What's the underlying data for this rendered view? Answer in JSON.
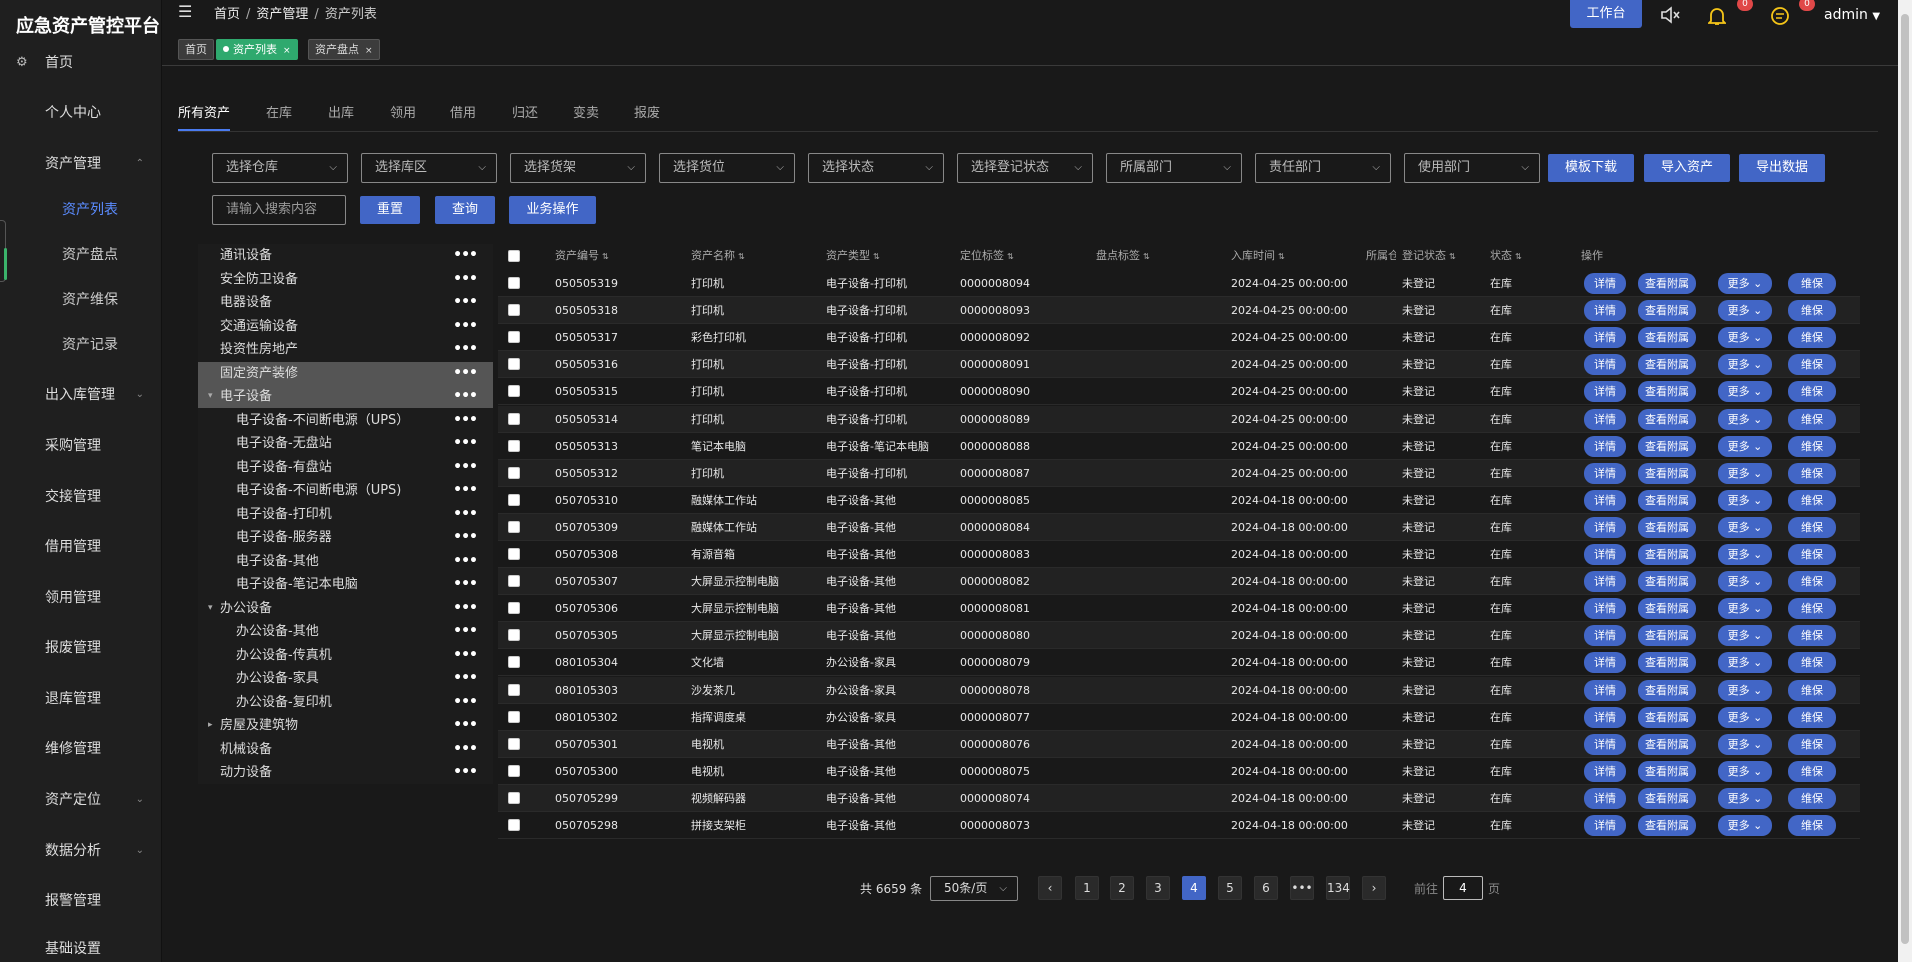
{
  "app": {
    "title": "应急资产管控平台"
  },
  "sidebar": {
    "items": [
      {
        "label": "首页"
      },
      {
        "label": "个人中心"
      },
      {
        "label": "资产管理"
      },
      {
        "label": "资产列表"
      },
      {
        "label": "资产盘点"
      },
      {
        "label": "资产维保"
      },
      {
        "label": "资产记录"
      },
      {
        "label": "出入库管理"
      },
      {
        "label": "采购管理"
      },
      {
        "label": "交接管理"
      },
      {
        "label": "借用管理"
      },
      {
        "label": "领用管理"
      },
      {
        "label": "报废管理"
      },
      {
        "label": "退库管理"
      },
      {
        "label": "维修管理"
      },
      {
        "label": "资产定位"
      },
      {
        "label": "数据分析"
      },
      {
        "label": "报警管理"
      },
      {
        "label": "基础设置"
      }
    ]
  },
  "header": {
    "breadcrumb": [
      "首页",
      "资产管理",
      "资产列表"
    ],
    "separator": "/",
    "workbench": "工作台",
    "bell_badge": "0",
    "chat_badge": "0",
    "user": "admin"
  },
  "tags": [
    {
      "label": "首页"
    },
    {
      "label": "资产列表",
      "close": "×"
    },
    {
      "label": "资产盘点",
      "close": "×"
    }
  ],
  "tabs": [
    "所有资产",
    "在库",
    "出库",
    "领用",
    "借用",
    "归还",
    "变卖",
    "报废"
  ],
  "filters": {
    "selects": [
      "选择仓库",
      "选择库区",
      "选择货架",
      "选择货位",
      "选择状态",
      "选择登记状态",
      "所属部门",
      "责任部门",
      "使用部门"
    ],
    "search_placeholder": "请输入搜索内容",
    "buttons": {
      "template": "模板下载",
      "import": "导入资产",
      "export": "导出数据",
      "reset": "重置",
      "query": "查询",
      "ops": "业务操作"
    }
  },
  "tree": {
    "more": "•••",
    "nodes": [
      {
        "label": "通讯设备",
        "level": 0
      },
      {
        "label": "安全防卫设备",
        "level": 0
      },
      {
        "label": "电器设备",
        "level": 0
      },
      {
        "label": "交通运输设备",
        "level": 0
      },
      {
        "label": "投资性房地产",
        "level": 0
      },
      {
        "label": "固定资产装修",
        "level": 0,
        "highlight": true
      },
      {
        "label": "电子设备",
        "level": 0,
        "toggle": "▾",
        "highlight": true
      },
      {
        "label": "电子设备-不间断电源（UPS）",
        "level": 1
      },
      {
        "label": "电子设备-无盘站",
        "level": 1
      },
      {
        "label": "电子设备-有盘站",
        "level": 1
      },
      {
        "label": "电子设备-不间断电源（UPS)",
        "level": 1
      },
      {
        "label": "电子设备-打印机",
        "level": 1
      },
      {
        "label": "电子设备-服务器",
        "level": 1
      },
      {
        "label": "电子设备-其他",
        "level": 1
      },
      {
        "label": "电子设备-笔记本电脑",
        "level": 1
      },
      {
        "label": "办公设备",
        "level": 0,
        "toggle": "▾"
      },
      {
        "label": "办公设备-其他",
        "level": 1
      },
      {
        "label": "办公设备-传真机",
        "level": 1
      },
      {
        "label": "办公设备-家具",
        "level": 1
      },
      {
        "label": "办公设备-复印机",
        "level": 1
      },
      {
        "label": "房屋及建筑物",
        "level": 0,
        "toggle": "▸"
      },
      {
        "label": "机械设备",
        "level": 0
      },
      {
        "label": "动力设备",
        "level": 0
      }
    ]
  },
  "table": {
    "columns": [
      "资产编号",
      "资产名称",
      "资产类型",
      "定位标签",
      "盘点标签",
      "入库时间",
      "所属仓",
      "登记状态",
      "状态",
      "操作"
    ],
    "actions": {
      "detail": "详情",
      "attach": "查看附属",
      "more": "更多",
      "maintain": "维保"
    },
    "rows": [
      [
        "050505319",
        "打印机",
        "电子设备-打印机",
        "0000008094",
        "",
        "2024-04-25 00:00:00",
        "",
        "未登记",
        "在库"
      ],
      [
        "050505318",
        "打印机",
        "电子设备-打印机",
        "0000008093",
        "",
        "2024-04-25 00:00:00",
        "",
        "未登记",
        "在库"
      ],
      [
        "050505317",
        "彩色打印机",
        "电子设备-打印机",
        "0000008092",
        "",
        "2024-04-25 00:00:00",
        "",
        "未登记",
        "在库"
      ],
      [
        "050505316",
        "打印机",
        "电子设备-打印机",
        "0000008091",
        "",
        "2024-04-25 00:00:00",
        "",
        "未登记",
        "在库"
      ],
      [
        "050505315",
        "打印机",
        "电子设备-打印机",
        "0000008090",
        "",
        "2024-04-25 00:00:00",
        "",
        "未登记",
        "在库"
      ],
      [
        "050505314",
        "打印机",
        "电子设备-打印机",
        "0000008089",
        "",
        "2024-04-25 00:00:00",
        "",
        "未登记",
        "在库"
      ],
      [
        "050505313",
        "笔记本电脑",
        "电子设备-笔记本电脑",
        "0000008088",
        "",
        "2024-04-25 00:00:00",
        "",
        "未登记",
        "在库"
      ],
      [
        "050505312",
        "打印机",
        "电子设备-打印机",
        "0000008087",
        "",
        "2024-04-25 00:00:00",
        "",
        "未登记",
        "在库"
      ],
      [
        "050705310",
        "融媒体工作站",
        "电子设备-其他",
        "0000008085",
        "",
        "2024-04-18 00:00:00",
        "",
        "未登记",
        "在库"
      ],
      [
        "050705309",
        "融媒体工作站",
        "电子设备-其他",
        "0000008084",
        "",
        "2024-04-18 00:00:00",
        "",
        "未登记",
        "在库"
      ],
      [
        "050705308",
        "有源音箱",
        "电子设备-其他",
        "0000008083",
        "",
        "2024-04-18 00:00:00",
        "",
        "未登记",
        "在库"
      ],
      [
        "050705307",
        "大屏显示控制电脑",
        "电子设备-其他",
        "0000008082",
        "",
        "2024-04-18 00:00:00",
        "",
        "未登记",
        "在库"
      ],
      [
        "050705306",
        "大屏显示控制电脑",
        "电子设备-其他",
        "0000008081",
        "",
        "2024-04-18 00:00:00",
        "",
        "未登记",
        "在库"
      ],
      [
        "050705305",
        "大屏显示控制电脑",
        "电子设备-其他",
        "0000008080",
        "",
        "2024-04-18 00:00:00",
        "",
        "未登记",
        "在库"
      ],
      [
        "080105304",
        "文化墙",
        "办公设备-家具",
        "0000008079",
        "",
        "2024-04-18 00:00:00",
        "",
        "未登记",
        "在库"
      ],
      [
        "080105303",
        "沙发茶几",
        "办公设备-家具",
        "0000008078",
        "",
        "2024-04-18 00:00:00",
        "",
        "未登记",
        "在库"
      ],
      [
        "080105302",
        "指挥调度桌",
        "办公设备-家具",
        "0000008077",
        "",
        "2024-04-18 00:00:00",
        "",
        "未登记",
        "在库"
      ],
      [
        "050705301",
        "电视机",
        "电子设备-其他",
        "0000008076",
        "",
        "2024-04-18 00:00:00",
        "",
        "未登记",
        "在库"
      ],
      [
        "050705300",
        "电视机",
        "电子设备-其他",
        "0000008075",
        "",
        "2024-04-18 00:00:00",
        "",
        "未登记",
        "在库"
      ],
      [
        "050705299",
        "视频解码器",
        "电子设备-其他",
        "0000008074",
        "",
        "2024-04-18 00:00:00",
        "",
        "未登记",
        "在库"
      ],
      [
        "050705298",
        "拼接支架柜",
        "电子设备-其他",
        "0000008073",
        "",
        "2024-04-18 00:00:00",
        "",
        "未登记",
        "在库"
      ]
    ]
  },
  "pager": {
    "total": "共 6659 条",
    "page_size": "50条/页",
    "pages": [
      "1",
      "2",
      "3",
      "4",
      "5",
      "6",
      "•••",
      "134"
    ],
    "current": "4",
    "goto_label": "前往",
    "goto_value": "4",
    "goto_suffix": "页"
  },
  "colors": {
    "accent": "#4266c6",
    "active_tag": "#2fa96e",
    "badge": "#e04848"
  }
}
